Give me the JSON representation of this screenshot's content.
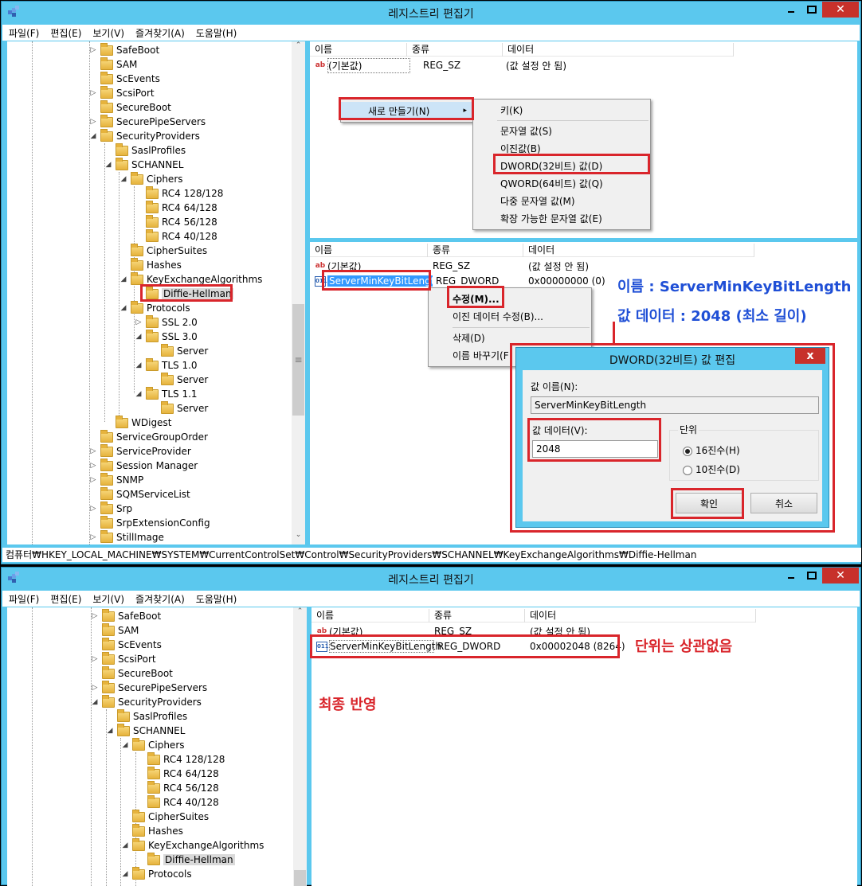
{
  "window1": {
    "title": "레지스트리 편집기",
    "menu": [
      "파일(F)",
      "편집(E)",
      "보기(V)",
      "즐겨찾기(A)",
      "도움말(H)"
    ],
    "tree": [
      {
        "label": "SafeBoot",
        "expander": "▷"
      },
      {
        "label": "SAM",
        "expander": ""
      },
      {
        "label": "ScEvents",
        "expander": ""
      },
      {
        "label": "ScsiPort",
        "expander": "▷"
      },
      {
        "label": "SecureBoot",
        "expander": ""
      },
      {
        "label": "SecurePipeServers",
        "expander": "▷"
      },
      {
        "label": "SecurityProviders",
        "expander": "◢"
      },
      {
        "label": "SaslProfiles",
        "expander": ""
      },
      {
        "label": "SCHANNEL",
        "expander": "◢"
      },
      {
        "label": "Ciphers",
        "expander": "◢"
      },
      {
        "label": "RC4 128/128",
        "expander": ""
      },
      {
        "label": "RC4 64/128",
        "expander": ""
      },
      {
        "label": "RC4 56/128",
        "expander": ""
      },
      {
        "label": "RC4 40/128",
        "expander": ""
      },
      {
        "label": "CipherSuites",
        "expander": ""
      },
      {
        "label": "Hashes",
        "expander": ""
      },
      {
        "label": "KeyExchangeAlgorithms",
        "expander": "◢"
      },
      {
        "label": "Diffie-Hellman",
        "expander": ""
      },
      {
        "label": "Protocols",
        "expander": "◢"
      },
      {
        "label": "SSL 2.0",
        "expander": "▷"
      },
      {
        "label": "SSL 3.0",
        "expander": "◢"
      },
      {
        "label": "Server",
        "expander": ""
      },
      {
        "label": "TLS 1.0",
        "expander": "◢"
      },
      {
        "label": "Server",
        "expander": ""
      },
      {
        "label": "TLS 1.1",
        "expander": "◢"
      },
      {
        "label": "Server",
        "expander": ""
      },
      {
        "label": "WDigest",
        "expander": ""
      },
      {
        "label": "ServiceGroupOrder",
        "expander": ""
      },
      {
        "label": "ServiceProvider",
        "expander": "▷"
      },
      {
        "label": "Session Manager",
        "expander": "▷"
      },
      {
        "label": "SNMP",
        "expander": "▷"
      },
      {
        "label": "SQMServiceList",
        "expander": ""
      },
      {
        "label": "Srp",
        "expander": "▷"
      },
      {
        "label": "SrpExtensionConfig",
        "expander": ""
      },
      {
        "label": "StillImage",
        "expander": "▷"
      }
    ],
    "list_top": {
      "headers": [
        "이름",
        "종류",
        "데이터"
      ],
      "rows": [
        {
          "name": "(기본값)",
          "type": "REG_SZ",
          "data": "(값 설정 안 됨)"
        }
      ]
    },
    "new_menu": {
      "label": "새로 만들기(N)",
      "arrow": "▸",
      "items": [
        "키(K)",
        "문자열 값(S)",
        "이진값(B)",
        "DWORD(32비트) 값(D)",
        "QWORD(64비트) 값(Q)",
        "다중 문자열 값(M)",
        "확장 가능한 문자열 값(E)"
      ]
    },
    "list_bottom": {
      "headers": [
        "이름",
        "종류",
        "데이터"
      ],
      "rows": [
        {
          "name": "(기본값)",
          "type": "REG_SZ",
          "data": "(값 설정 안 됨)"
        },
        {
          "name": "ServerMinKeyBitLength",
          "type": "REG_DWORD",
          "data": "0x00000000 (0)"
        }
      ]
    },
    "ctx_menu": [
      "수정(M)...",
      "이진 데이터 수정(B)...",
      "삭제(D)",
      "이름 바꾸기(R)"
    ],
    "ctx_menu_visible": [
      "수정(M)...",
      "이진 데이터 수정(B)...",
      "삭제(D)",
      "이름 바꾸기(F"
    ],
    "status": "컴퓨터₩HKEY_LOCAL_MACHINE₩SYSTEM₩CurrentControlSet₩Control₩SecurityProviders₩SCHANNEL₩KeyExchangeAlgorithms₩Diffie-Hellman",
    "annotation_name": "이름 : ServerMinKeyBitLength",
    "annotation_value": "값 데이터  : 2048 (최소 길이)"
  },
  "dialog": {
    "title": "DWORD(32비트) 값 편집",
    "close": "x",
    "name_label": "값 이름(N):",
    "name_value": "ServerMinKeyBitLength",
    "data_label": "값 데이터(V):",
    "data_value": "2048",
    "base_label": "단위",
    "hex_label": "16진수(H)",
    "dec_label": "10진수(D)",
    "ok": "확인",
    "cancel": "취소"
  },
  "window2": {
    "title": "레지스트리 편집기",
    "menu": [
      "파일(F)",
      "편집(E)",
      "보기(V)",
      "즐겨찾기(A)",
      "도움말(H)"
    ],
    "tree": [
      {
        "label": "SafeBoot",
        "expander": "▷"
      },
      {
        "label": "SAM",
        "expander": ""
      },
      {
        "label": "ScEvents",
        "expander": ""
      },
      {
        "label": "ScsiPort",
        "expander": "▷"
      },
      {
        "label": "SecureBoot",
        "expander": ""
      },
      {
        "label": "SecurePipeServers",
        "expander": "▷"
      },
      {
        "label": "SecurityProviders",
        "expander": "◢"
      },
      {
        "label": "SaslProfiles",
        "expander": ""
      },
      {
        "label": "SCHANNEL",
        "expander": "◢"
      },
      {
        "label": "Ciphers",
        "expander": "◢"
      },
      {
        "label": "RC4 128/128",
        "expander": ""
      },
      {
        "label": "RC4 64/128",
        "expander": ""
      },
      {
        "label": "RC4 56/128",
        "expander": ""
      },
      {
        "label": "RC4 40/128",
        "expander": ""
      },
      {
        "label": "CipherSuites",
        "expander": ""
      },
      {
        "label": "Hashes",
        "expander": ""
      },
      {
        "label": "KeyExchangeAlgorithms",
        "expander": "◢"
      },
      {
        "label": "Diffie-Hellman",
        "expander": ""
      },
      {
        "label": "Protocols",
        "expander": "◢"
      }
    ],
    "list": {
      "headers": [
        "이름",
        "종류",
        "데이터"
      ],
      "rows": [
        {
          "name": "(기본값)",
          "type": "REG_SZ",
          "data": "(값 설정 안 됨)"
        },
        {
          "name": "ServerMinKeyBitLength",
          "type": "REG_DWORD",
          "data": "0x00002048 (8264)"
        }
      ]
    },
    "annotation_unit": "단위는 상관없음",
    "annotation_final": "최종 반영"
  },
  "icons": {
    "app": "registry-editor-icon",
    "folder": "folder-icon",
    "string_value": "string-value-icon",
    "binary_value": "binary-value-icon"
  },
  "colors": {
    "titlebar": "#5bc8ee",
    "close": "#c7312b",
    "highlight_box": "#d9252b",
    "annotation_blue": "#1f4fd6",
    "annotation_red": "#d9252b",
    "selection": "#3399ff"
  }
}
